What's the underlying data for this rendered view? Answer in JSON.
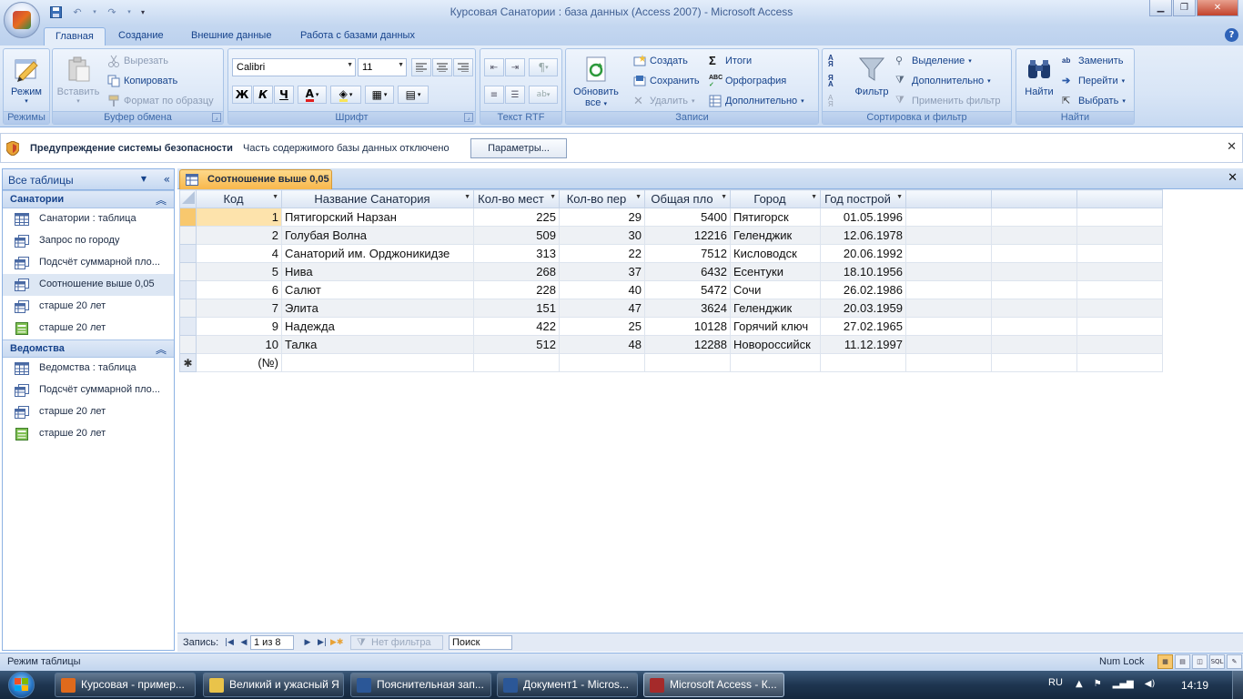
{
  "window": {
    "title": "Курсовая Санатории : база данных (Access 2007) - Microsoft Access",
    "help": "?"
  },
  "tabs": [
    {
      "label": "Главная"
    },
    {
      "label": "Создание"
    },
    {
      "label": "Внешние данные"
    },
    {
      "label": "Работа с базами данных"
    }
  ],
  "ribbon": {
    "groups": {
      "views": "Режимы",
      "clipboard": "Буфер обмена",
      "font": "Шрифт",
      "rtf": "Текст RTF",
      "records": "Записи",
      "sort_filter": "Сортировка и фильтр",
      "find": "Найти"
    },
    "view_btn": "Режим",
    "paste_btn": "Вставить",
    "cut": "Вырезать",
    "copy": "Копировать",
    "format_painter": "Формат по образцу",
    "font_name": "Calibri",
    "font_size": "11",
    "bold": "Ж",
    "italic": "К",
    "underline": "Ч",
    "refresh_btn_1": "Обновить",
    "refresh_btn_2": "все",
    "new": "Создать",
    "save": "Сохранить",
    "delete": "Удалить",
    "totals": "Итоги",
    "spelling": "Орфография",
    "more": "Дополнительно",
    "filter_btn": "Фильтр",
    "selection": "Выделение",
    "advanced": "Дополнительно",
    "toggle_filter": "Применить фильтр",
    "find_btn": "Найти",
    "replace": "Заменить",
    "goto": "Перейти",
    "select": "Выбрать"
  },
  "security": {
    "title": "Предупреждение системы безопасности",
    "text": "Часть содержимого базы данных отключено",
    "button": "Параметры..."
  },
  "nav": {
    "title": "Все таблицы",
    "groups": [
      {
        "title": "Санатории",
        "items": [
          {
            "label": "Санатории : таблица",
            "icon": "table-icon"
          },
          {
            "label": "Запрос по городу",
            "icon": "query-icon"
          },
          {
            "label": "Подсчёт суммарной пло...",
            "icon": "query-icon"
          },
          {
            "label": "Соотношение выше 0,05",
            "icon": "query-icon"
          },
          {
            "label": "старше 20 лет",
            "icon": "query-icon"
          },
          {
            "label": "старше 20 лет",
            "icon": "report-icon"
          }
        ]
      },
      {
        "title": "Ведомства",
        "items": [
          {
            "label": "Ведомства : таблица",
            "icon": "table-icon"
          },
          {
            "label": "Подсчёт суммарной пло...",
            "icon": "query-icon"
          },
          {
            "label": "старше 20 лет",
            "icon": "query-icon"
          },
          {
            "label": "старше 20 лет",
            "icon": "report-icon"
          }
        ]
      }
    ]
  },
  "document": {
    "tab_label": "Соотношение выше 0,05",
    "columns": [
      "Код",
      "Название Санатория",
      "Кол-во мест",
      "Кол-во пер",
      "Общая пло",
      "Город",
      "Год построй"
    ],
    "rows": [
      [
        "1",
        "Пятигорский Нарзан",
        "225",
        "29",
        "5400",
        "Пятигорск",
        "01.05.1996"
      ],
      [
        "2",
        "Голубая Волна",
        "509",
        "30",
        "12216",
        "Геленджик",
        "12.06.1978"
      ],
      [
        "4",
        "Санаторий им. Орджоникидзе",
        "313",
        "22",
        "7512",
        "Кисловодск",
        "20.06.1992"
      ],
      [
        "5",
        "Нива",
        "268",
        "37",
        "6432",
        "Есентуки",
        "18.10.1956"
      ],
      [
        "6",
        "Салют",
        "228",
        "40",
        "5472",
        "Сочи",
        "26.02.1986"
      ],
      [
        "7",
        "Элита",
        "151",
        "47",
        "3624",
        "Геленджик",
        "20.03.1959"
      ],
      [
        "9",
        "Надежда",
        "422",
        "25",
        "10128",
        "Горячий ключ",
        "27.02.1965"
      ],
      [
        "10",
        "Талка",
        "512",
        "48",
        "12288",
        "Новороссийск",
        "11.12.1997"
      ]
    ],
    "new_row_marker": "✱",
    "new_row_id": "(№)"
  },
  "record_nav": {
    "label": "Запись:",
    "current": "1 из 8",
    "filter": "Нет фильтра",
    "search": "Поиск"
  },
  "status": {
    "left": "Режим таблицы",
    "numlock": "Num Lock"
  },
  "taskbar": {
    "tasks": [
      {
        "label": "Курсовая - пример...",
        "color": "#e06a1c"
      },
      {
        "label": "Великий и ужасный Я",
        "color": "#e9c34a"
      },
      {
        "label": "Пояснительная зап...",
        "color": "#2b5797"
      },
      {
        "label": "Документ1 - Micros...",
        "color": "#2b5797"
      },
      {
        "label": "Microsoft Access - К...",
        "color": "#a52a2a"
      }
    ],
    "lang": "RU",
    "clock": "14:19"
  },
  "colors": {
    "accent": "#15428b",
    "selected_tab": "#f8b74c",
    "ribbon_bg": "#dbe7f7"
  }
}
